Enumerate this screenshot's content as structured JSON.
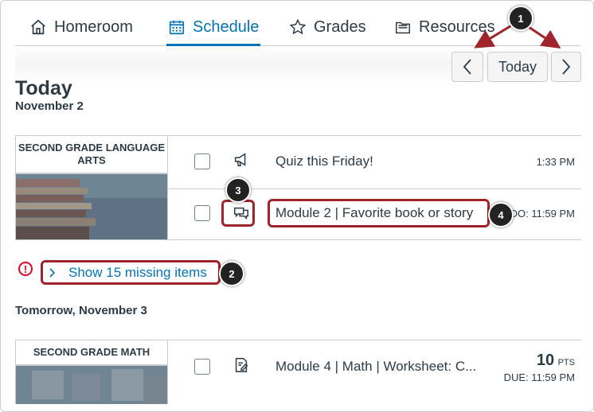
{
  "tabs": [
    {
      "label": "Homeroom",
      "icon": "home-icon",
      "active": false
    },
    {
      "label": "Schedule",
      "icon": "calendar-icon",
      "active": true
    },
    {
      "label": "Grades",
      "icon": "star-icon",
      "active": false
    },
    {
      "label": "Resources",
      "icon": "folder-icon",
      "active": false
    }
  ],
  "nav": {
    "today_label": "Today",
    "prev_icon": "chevron-left-icon",
    "next_icon": "chevron-right-icon"
  },
  "today": {
    "heading": "Today",
    "date": "November 2"
  },
  "card1": {
    "course": "SECOND GRADE LANGUAGE ARTS",
    "items": [
      {
        "title": "Quiz this Friday!",
        "time": "1:33 PM",
        "icon": "announcement-icon"
      },
      {
        "title": "Module 2 | Favorite book or story",
        "time": "DO: 11:59 PM",
        "icon": "discussion-icon"
      }
    ]
  },
  "missing": {
    "label": "Show 15 missing items",
    "icon": "warning-icon"
  },
  "tomorrow": {
    "heading": "Tomorrow, November 3"
  },
  "card2": {
    "course": "SECOND GRADE MATH",
    "items": [
      {
        "title": "Module 4 | Math | Worksheet: C...",
        "points": "10",
        "points_unit": "PTS",
        "due": "DUE: 11:59 PM",
        "icon": "assignment-icon"
      }
    ]
  },
  "annotations": [
    "1",
    "2",
    "3",
    "4"
  ],
  "colors": {
    "accent": "#0374b5",
    "annotation": "#a1232b",
    "warning": "#e0061f"
  }
}
